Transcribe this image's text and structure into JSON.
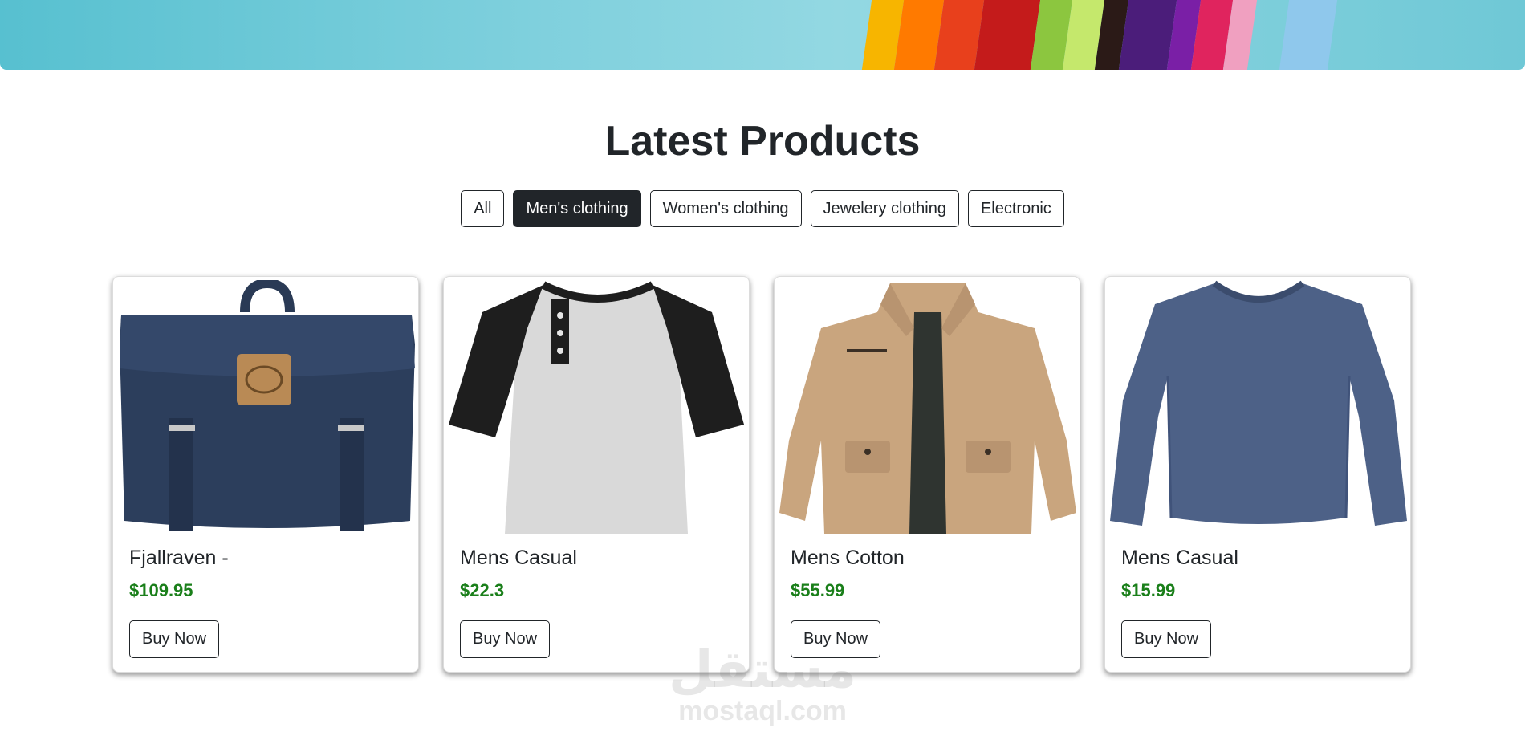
{
  "page": {
    "title": "Latest Products"
  },
  "filters": [
    {
      "label": "All",
      "active": false
    },
    {
      "label": "Men's clothing",
      "active": true
    },
    {
      "label": "Women's clothing",
      "active": false
    },
    {
      "label": "Jewelery clothing",
      "active": false
    },
    {
      "label": "Electronic",
      "active": false
    }
  ],
  "products": [
    {
      "title": "Fjallraven -",
      "price": "$109.95",
      "button": "Buy Now",
      "icon": "backpack-image"
    },
    {
      "title": "Mens Casual",
      "price": "$22.3",
      "button": "Buy Now",
      "icon": "raglan-tshirt-image"
    },
    {
      "title": "Mens Cotton",
      "price": "$55.99",
      "button": "Buy Now",
      "icon": "cotton-jacket-image"
    },
    {
      "title": "Mens Casual",
      "price": "$15.99",
      "button": "Buy Now",
      "icon": "long-sleeve-shirt-image"
    }
  ],
  "watermark": {
    "logo": "مستقل",
    "text": "mostaql.com"
  },
  "colors": {
    "accent_dark": "#212529",
    "price_green": "#1a7f1a",
    "hero_bg": "#7fd0dd"
  }
}
